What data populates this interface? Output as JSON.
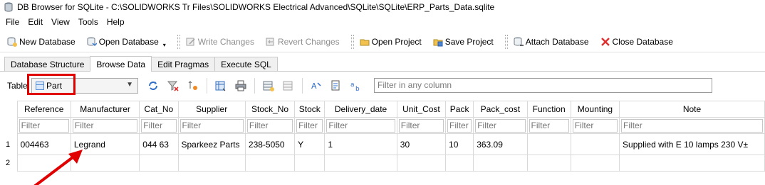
{
  "window": {
    "title": "DB Browser for SQLite - C:\\SOLIDWORKS Tr Files\\SOLIDWORKS Electrical Advanced\\SQLite\\SQLite\\ERP_Parts_Data.sqlite"
  },
  "menu": [
    "File",
    "Edit",
    "View",
    "Tools",
    "Help"
  ],
  "toolbar": {
    "new_database": "New Database",
    "open_database": "Open Database",
    "write_changes": "Write Changes",
    "revert_changes": "Revert Changes",
    "open_project": "Open Project",
    "save_project": "Save Project",
    "attach_database": "Attach Database",
    "close_database": "Close Database"
  },
  "tabs": [
    "Database Structure",
    "Browse Data",
    "Edit Pragmas",
    "Execute SQL"
  ],
  "active_tab": "Browse Data",
  "browse": {
    "table_label": "Table:",
    "selected_table": "Part",
    "global_filter_placeholder": "Filter in any column",
    "filter_placeholder": "Filter"
  },
  "grid": {
    "columns": [
      "Reference",
      "Manufacturer",
      "Cat_No",
      "Supplier",
      "Stock_No",
      "Stock",
      "Delivery_date",
      "Unit_Cost",
      "Pack",
      "Pack_cost",
      "Function",
      "Mounting",
      "Note"
    ],
    "rows": [
      {
        "num": "1",
        "cells": [
          "004463",
          "Legrand",
          "044 63",
          "Sparkeez Parts",
          "238-5050",
          "Y",
          "1",
          "30",
          "10",
          "363.09",
          "",
          "",
          "Supplied with E 10 lamps 230 V±"
        ]
      },
      {
        "num": "2",
        "cells": [
          "",
          "",
          "",
          "",
          "",
          "",
          "",
          "",
          "",
          "",
          "",
          "",
          ""
        ]
      }
    ]
  },
  "colors": {
    "highlight": "#e00000",
    "arrow": "#e00000"
  }
}
